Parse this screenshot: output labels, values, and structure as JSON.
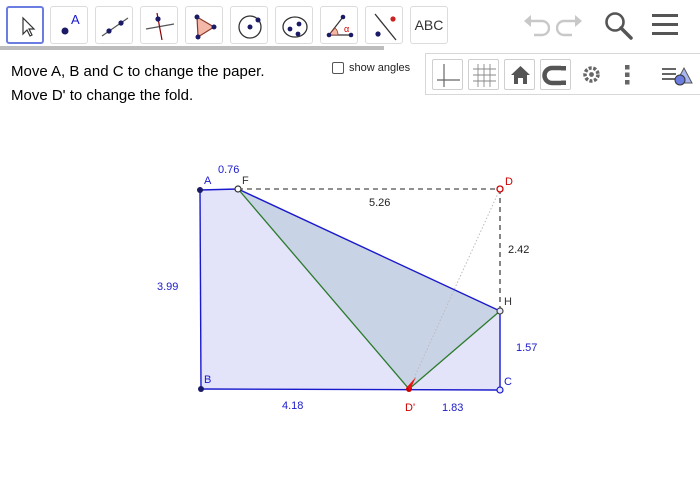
{
  "toolbar": {
    "tools": [
      {
        "name": "move-tool"
      },
      {
        "name": "point-tool",
        "glyph": "A"
      },
      {
        "name": "line-tool"
      },
      {
        "name": "perpendicular-line-tool"
      },
      {
        "name": "polygon-tool"
      },
      {
        "name": "circle-center-point-tool"
      },
      {
        "name": "ellipse-tool"
      },
      {
        "name": "angle-tool",
        "glyph": "α"
      },
      {
        "name": "reflect-about-line-tool"
      },
      {
        "name": "text-tool",
        "label": "ABC"
      }
    ],
    "right_icons": [
      "undo-icon",
      "redo-icon",
      "search-icon",
      "menu-icon"
    ]
  },
  "instructions": {
    "line1": "Move A, B and C to change the paper.",
    "line2": "Move D' to change the fold."
  },
  "show_angles": {
    "label": "show angles",
    "checked": false
  },
  "style_bar": {
    "buttons": [
      "axes-icon",
      "grid-icon",
      "home-icon",
      "point-capturing-icon",
      "settings-icon",
      "more-options-icon",
      "toggle-style-bar-icon"
    ]
  },
  "colors": {
    "selected_border": "#6b7de0",
    "paper_fill": "#e3e3fa",
    "fold_fill": "#c9d3e6",
    "edge_blue": "#1a1acc",
    "fold_green": "#2a7a2a",
    "label_blue": "#1a1acc",
    "d_red": "#cc0000"
  },
  "geometry": {
    "points": {
      "A": {
        "label": "A"
      },
      "B": {
        "label": "B"
      },
      "C": {
        "label": "C"
      },
      "D": {
        "label": "D"
      },
      "Dprime": {
        "label": "D'"
      },
      "F": {
        "label": "F"
      },
      "H": {
        "label": "H"
      }
    },
    "measurements": {
      "AF": "0.76",
      "FD": "5.26",
      "DH": "2.42",
      "AB": "3.99",
      "HC": "1.57",
      "BDprime": "4.18",
      "DprimeC": "1.83"
    }
  }
}
